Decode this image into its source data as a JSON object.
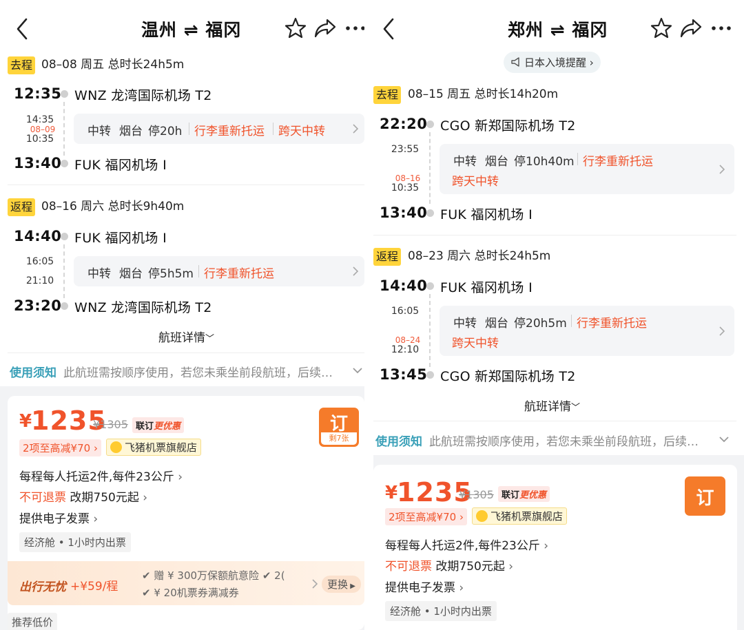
{
  "left": {
    "title": "温州 ⇌ 福冈",
    "outbound": {
      "tag": "去程",
      "info": "08–08  周五  总时长24h5m",
      "dep_time": "12:35",
      "dep_airport": "WNZ 龙湾国际机场 T2",
      "stop_arr_time": "14:35",
      "stop_dep_date": "08–09",
      "stop_dep_time": "10:35",
      "transfer_label": "中转",
      "transfer_city": "烟台",
      "transfer_stay": "停20h",
      "transfer_note1": "行李重新托运",
      "transfer_note2": "跨天中转",
      "arr_time": "13:40",
      "arr_airport": "FUK 福冈机场 I"
    },
    "inbound": {
      "tag": "返程",
      "info": "08–16  周六  总时长9h40m",
      "dep_time": "14:40",
      "dep_airport": "FUK 福冈机场 I",
      "stop_arr_time": "16:05",
      "stop_dep_time": "21:10",
      "transfer_label": "中转",
      "transfer_city": "烟台",
      "transfer_stay": "停5h5m",
      "transfer_note1": "行李重新托运",
      "arr_time": "23:20",
      "arr_airport": "WNZ 龙湾国际机场 T2"
    },
    "details_link": "航班详情",
    "notice_title": "使用须知",
    "notice_text": "此航班需按顺序使用，若您未乘坐前段航班，后续…",
    "price": {
      "currency": "¥",
      "value": "1235",
      "original": "¥1305",
      "promo_prefix": "联订",
      "promo_accent": "更优惠",
      "reduce": "2项至高减¥70",
      "store": "飞猪机票旗舰店",
      "baggage": "每程每人托运2件,每件23公斤",
      "refund_red": "不可退票",
      "refund_rest": "改期750元起",
      "invoice": "提供电子发票",
      "cabin": "经济舱 • 1小时内出票",
      "book_label": "订",
      "book_remain": "剩7张"
    },
    "trip": {
      "title": "出行无忧",
      "price": "+¥59/程",
      "perk1": "✔ 赠 ¥ 300万保额航意险  ✔ 2(",
      "perk2": "✔ ¥ 20机票券满减券",
      "change": "更换"
    },
    "recommend": "推荐低价"
  },
  "right": {
    "title": "郑州 ⇌ 福冈",
    "reminder": "日本入境提醒",
    "outbound": {
      "tag": "去程",
      "info": "08–15  周五  总时长14h20m",
      "dep_time": "22:20",
      "dep_airport": "CGO 新郑国际机场 T2",
      "stop_arr_time": "23:55",
      "stop_dep_date": "08–16",
      "stop_dep_time": "10:35",
      "transfer_label": "中转",
      "transfer_city": "烟台",
      "transfer_stay": "停10h40m",
      "transfer_note1": "行李重新托运",
      "transfer_note2": "跨天中转",
      "arr_time": "13:40",
      "arr_airport": "FUK 福冈机场 I"
    },
    "inbound": {
      "tag": "返程",
      "info": "08–23  周六  总时长24h5m",
      "dep_time": "14:40",
      "dep_airport": "FUK 福冈机场 I",
      "stop_arr_time": "16:05",
      "stop_dep_date": "08–24",
      "stop_dep_time": "12:10",
      "transfer_label": "中转",
      "transfer_city": "烟台",
      "transfer_stay": "停20h5m",
      "transfer_note1": "行李重新托运",
      "transfer_note2": "跨天中转",
      "arr_time": "13:45",
      "arr_airport": "CGO 新郑国际机场 T2"
    },
    "details_link": "航班详情",
    "notice_title": "使用须知",
    "notice_text": "此航班需按顺序使用，若您未乘坐前段航班，后续…",
    "price": {
      "currency": "¥",
      "value": "1235",
      "original": "¥1305",
      "promo_prefix": "联订",
      "promo_accent": "更优惠",
      "reduce": "2项至高减¥70",
      "store": "飞猪机票旗舰店",
      "baggage": "每程每人托运2件,每件23公斤",
      "refund_red": "不可退票",
      "refund_rest": "改期750元起",
      "invoice": "提供电子发票",
      "cabin": "经济舱 • 1小时内出票",
      "book_label": "订"
    }
  },
  "icons": {
    "back": "chevron-left-icon",
    "favorite": "star-icon",
    "share": "share-icon",
    "more": "more-dots-icon",
    "reminder": "megaphone-icon"
  },
  "colors": {
    "accent": "#f0532b",
    "book_button": "#f57b2a",
    "leg_tag": "#ffd43b",
    "notice": "#3aa0b8"
  }
}
